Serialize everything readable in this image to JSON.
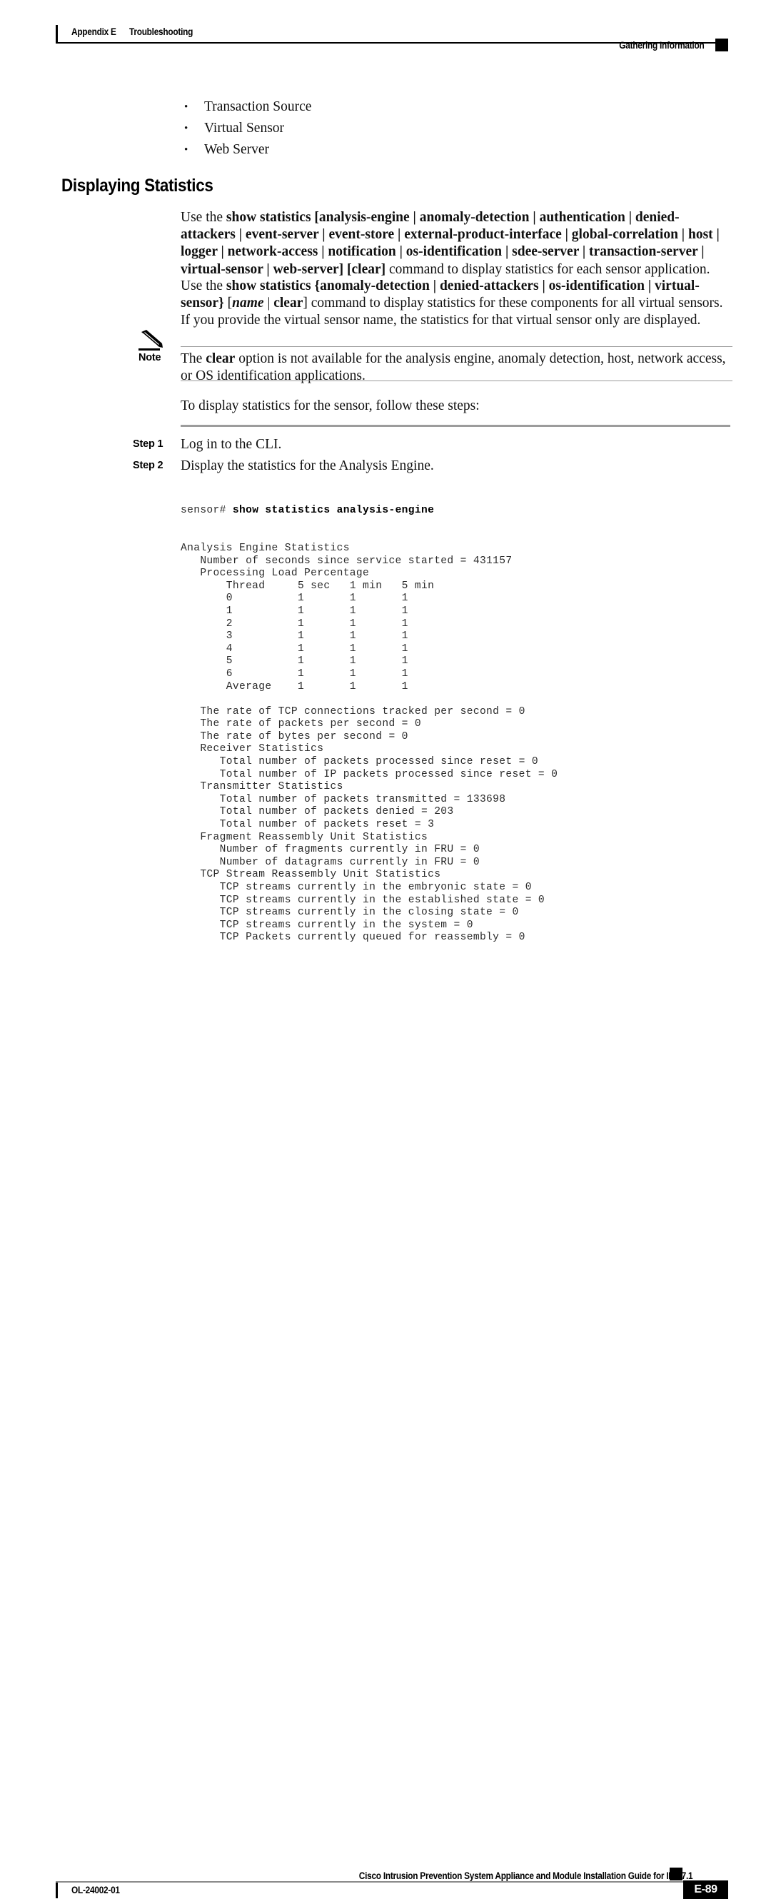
{
  "header": {
    "appendix": "Appendix E",
    "section_title": "Troubleshooting",
    "running_head": "Gathering Information",
    "square_icon": "black-square-icon"
  },
  "bullets": [
    "Transaction Source",
    "Virtual Sensor",
    "Web Server"
  ],
  "heading": "Displaying Statistics",
  "paragraphs": {
    "syntax1": {
      "prefix": "Use the ",
      "bold_command": "show statistics [analysis-engine | anomaly-detection | authentication | denied-attackers | event-server | event-store | external-product-interface | global-correlation | host | logger | network-access | notification | os-identification | sdee-server | transaction-server | virtual-sensor | web-server] [clear]",
      "suffix": " command to display statistics for each sensor application."
    },
    "syntax2": {
      "prefix": "Use the ",
      "bold_command": "show statistics {anomaly-detection | denied-attackers | os-identification | virtual-sensor}",
      "bracket_open": "[",
      "italic_name": "name",
      "pipe": " | ",
      "bold_clear": "clear",
      "bracket_close": "]",
      "suffix": " command to display statistics for these components for all virtual sensors. If you provide the virtual sensor name, the statistics for that virtual sensor only are displayed."
    },
    "intro_steps": "To display statistics for the sensor, follow these steps:"
  },
  "note": {
    "icon": "pencil-icon",
    "label": "Note",
    "text_before_bold": "The ",
    "bold_word": "clear",
    "text_after_bold": " option is not available for the analysis engine, anomaly detection, host, network access, or OS identification applications."
  },
  "steps": [
    {
      "label": "Step 1",
      "text": "Log in to the CLI."
    },
    {
      "label": "Step 2",
      "text": "Display the statistics for the Analysis Engine."
    }
  ],
  "code": {
    "prompt": "sensor# ",
    "command": "show statistics analysis-engine",
    "lines": [
      "Analysis Engine Statistics",
      "   Number of seconds since service started = 431157",
      "   Processing Load Percentage",
      "       Thread     5 sec   1 min   5 min",
      "       0          1       1       1",
      "       1          1       1       1",
      "       2          1       1       1",
      "       3          1       1       1",
      "       4          1       1       1",
      "       5          1       1       1",
      "       6          1       1       1",
      "       Average    1       1       1",
      "",
      "   The rate of TCP connections tracked per second = 0",
      "   The rate of packets per second = 0",
      "   The rate of bytes per second = 0",
      "   Receiver Statistics",
      "      Total number of packets processed since reset = 0",
      "      Total number of IP packets processed since reset = 0",
      "   Transmitter Statistics",
      "      Total number of packets transmitted = 133698",
      "      Total number of packets denied = 203",
      "      Total number of packets reset = 3",
      "   Fragment Reassembly Unit Statistics",
      "      Number of fragments currently in FRU = 0",
      "      Number of datagrams currently in FRU = 0",
      "   TCP Stream Reassembly Unit Statistics",
      "      TCP streams currently in the embryonic state = 0",
      "      TCP streams currently in the established state = 0",
      "      TCP streams currently in the closing state = 0",
      "      TCP streams currently in the system = 0",
      "      TCP Packets currently queued for reassembly = 0"
    ]
  },
  "footer": {
    "guide_title": "Cisco Intrusion Prevention System Appliance and Module Installation Guide for IPS 7.1",
    "doc_number": "OL-24002-01",
    "page_number": "E-89",
    "square_icon": "black-square-icon"
  },
  "colors": {
    "text": "#111111",
    "rule_gray": "#9c9c9c",
    "code_text": "#2b2b2b",
    "black": "#000000"
  }
}
